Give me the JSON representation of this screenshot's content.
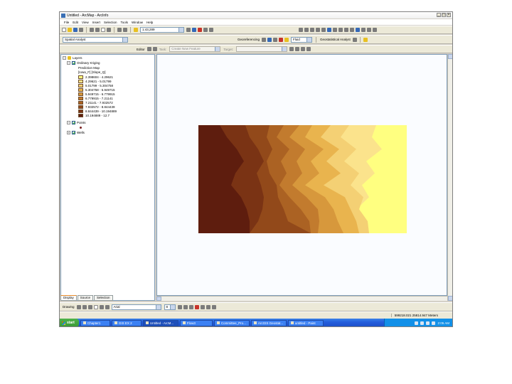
{
  "window": {
    "title": "Untitled - ArcMap - ArcInfo",
    "controls": [
      "_",
      "□",
      "×"
    ]
  },
  "menu": [
    "File",
    "Edit",
    "View",
    "Insert",
    "Selection",
    "Tools",
    "Window",
    "Help"
  ],
  "toolbar_standard": {
    "scale": "1:43,289"
  },
  "toolbar_spatial_analyst": {
    "label": "Spatial Analyst",
    "layer_label": "Geostatistical Analyst",
    "georef_label": "Georeferencing",
    "layer_value": "Fluid"
  },
  "toolbar_editor": {
    "editor_label": "Editor",
    "task_label": "Task:",
    "task_value": "Create New Feature",
    "target_label": "Target:"
  },
  "toc": {
    "root": "Layers",
    "layers": [
      {
        "name": "Ordinary Kriging",
        "sub": [
          "Prediction Map",
          "[Iowa_F] [Slope_Q]"
        ],
        "classes": [
          {
            "label": "2.398604 - 4.29621",
            "color": "#ffff80"
          },
          {
            "label": "4.29621 - 5.01799",
            "color": "#fbe38c"
          },
          {
            "label": "5.01799 - 5.304758",
            "color": "#f4d074"
          },
          {
            "label": "5.304758 - 5.949715",
            "color": "#e9b44e"
          },
          {
            "label": "5.949715 - 6.779915",
            "color": "#d7983c"
          },
          {
            "label": "6.779915 - 7.21141",
            "color": "#c27b2e"
          },
          {
            "label": "7.21141 - 7.932572",
            "color": "#ab6223"
          },
          {
            "label": "7.932572 - 8.844439",
            "color": "#92491a"
          },
          {
            "label": "8.844439 - 10.194889",
            "color": "#7a3314"
          },
          {
            "label": "10.194889 - 12.7",
            "color": "#5e1d0e"
          }
        ]
      },
      {
        "name": "Points",
        "sub": []
      },
      {
        "name": "Wells",
        "sub": []
      }
    ],
    "tabs": [
      "Display",
      "Source",
      "Selection"
    ]
  },
  "map": {
    "colors": [
      "#ffff80",
      "#fbe38c",
      "#f4d074",
      "#e9b44e",
      "#d7983c",
      "#c27b2e",
      "#ab6223",
      "#92491a",
      "#7a3314",
      "#5e1d0e"
    ]
  },
  "drawing_toolbar": {
    "label": "Drawing",
    "font": "Arial",
    "size": "8"
  },
  "status": {
    "coords": "599218.021 25814.947 Meters"
  },
  "taskbar": {
    "start": "start",
    "tasks": [
      "Chapter1",
      "GIS EX 2",
      "Untitled - ArcM...",
      "Flow3",
      "Committee_Pro...",
      "ArcGIS Geostat...",
      "untitled - Paint"
    ],
    "active_index": 2,
    "clock": "2:05 AM"
  }
}
